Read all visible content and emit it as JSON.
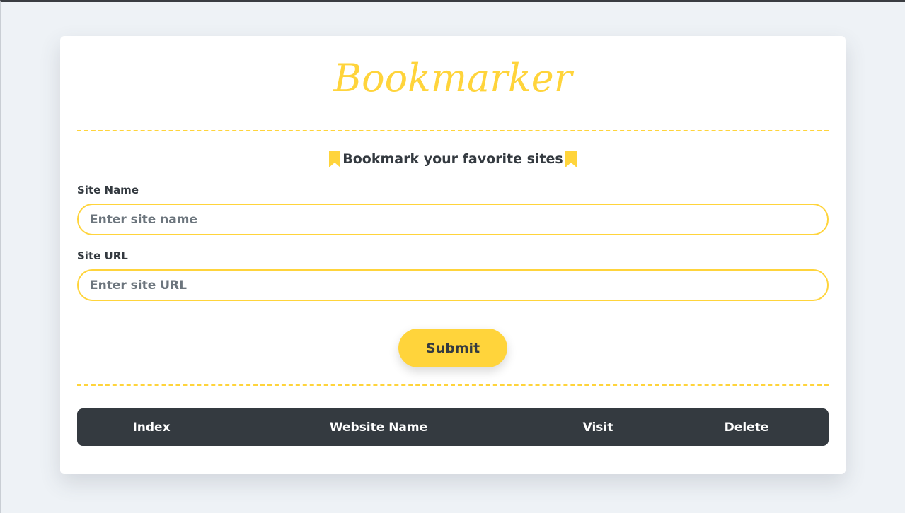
{
  "app": {
    "title": "Bookmarker"
  },
  "form": {
    "heading": "Bookmark your favorite sites",
    "site_name": {
      "label": "Site Name",
      "placeholder": "Enter site name",
      "value": ""
    },
    "site_url": {
      "label": "Site URL",
      "placeholder": "Enter site URL",
      "value": ""
    },
    "submit_label": "Submit"
  },
  "table": {
    "columns": [
      "Index",
      "Website Name",
      "Visit",
      "Delete"
    ],
    "rows": []
  },
  "icons": {
    "heading_left": "bookmark-icon",
    "heading_right": "bookmark-icon"
  },
  "colors": {
    "accent": "#ffd43b",
    "dark": "#343a40",
    "background": "#eef2f6",
    "card": "#ffffff",
    "placeholder": "#6c757d"
  }
}
